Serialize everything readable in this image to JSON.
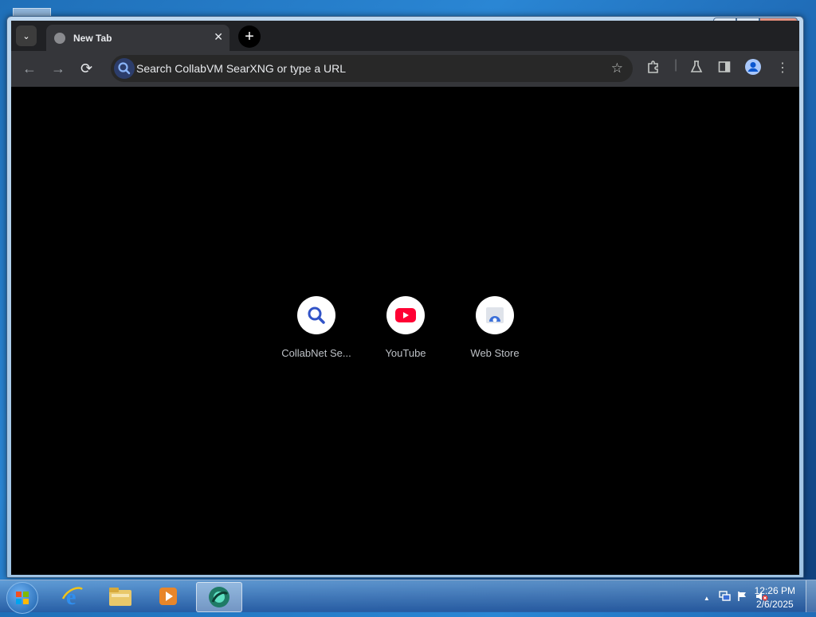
{
  "browser": {
    "tab_title": "New Tab",
    "tab_close": "✕",
    "new_tab": "+",
    "omnibox_placeholder": "Search CollabVM SearXNG or type a URL",
    "captions": {
      "minimize": "–",
      "maximize": "❐",
      "close": "✕"
    }
  },
  "shortcuts": [
    {
      "label": "CollabNet Se...",
      "icon": "search-icon"
    },
    {
      "label": "YouTube",
      "icon": "youtube-icon"
    },
    {
      "label": "Web Store",
      "icon": "webstore-icon"
    }
  ],
  "taskbar": {
    "time": "12:26 PM",
    "date": "2/6/2025",
    "tray_arrow": "▲"
  },
  "colors": {
    "toolbar": "#35363a",
    "tabstrip": "#202124",
    "content": "#000000",
    "youtube_red": "#ff0033"
  }
}
